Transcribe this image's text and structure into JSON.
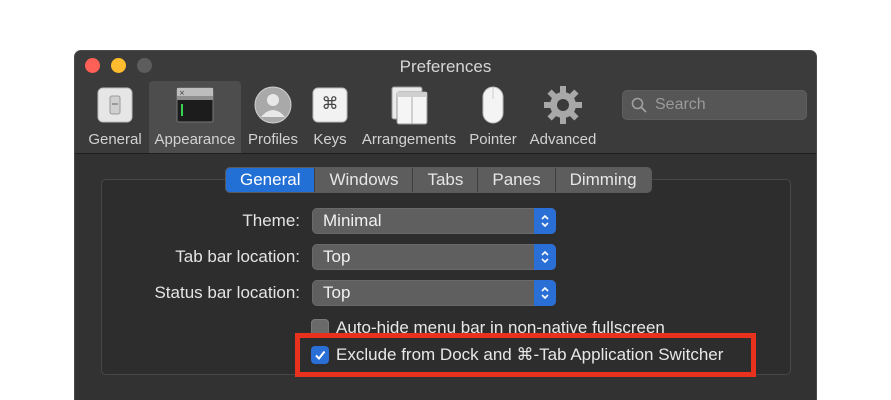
{
  "window": {
    "title": "Preferences"
  },
  "toolbar": {
    "items": [
      {
        "label": "General",
        "icon": "general-switch-icon",
        "selected": false
      },
      {
        "label": "Appearance",
        "icon": "appearance-window-icon",
        "selected": true
      },
      {
        "label": "Profiles",
        "icon": "profiles-person-icon",
        "selected": false
      },
      {
        "label": "Keys",
        "icon": "keys-command-icon",
        "selected": false
      },
      {
        "label": "Arrangements",
        "icon": "arrangements-windows-icon",
        "selected": false
      },
      {
        "label": "Pointer",
        "icon": "pointer-mouse-icon",
        "selected": false
      },
      {
        "label": "Advanced",
        "icon": "advanced-gear-icon",
        "selected": false
      }
    ],
    "keys_glyph": "⌘"
  },
  "search": {
    "placeholder": "Search"
  },
  "tabs": {
    "items": [
      "General",
      "Windows",
      "Tabs",
      "Panes",
      "Dimming"
    ],
    "active": "General"
  },
  "settings": {
    "theme": {
      "label": "Theme:",
      "value": "Minimal"
    },
    "tab_bar_location": {
      "label": "Tab bar location:",
      "value": "Top"
    },
    "status_bar_location": {
      "label": "Status bar location:",
      "value": "Top"
    },
    "auto_hide_menu": {
      "label": "Auto-hide menu bar in non-native fullscreen",
      "checked": false
    },
    "exclude_dock": {
      "label": "Exclude from Dock and ⌘-Tab Application Switcher",
      "checked": true
    }
  },
  "colors": {
    "accent": "#2270d6",
    "highlight_border": "#e8321e",
    "window_bg": "#323232"
  }
}
